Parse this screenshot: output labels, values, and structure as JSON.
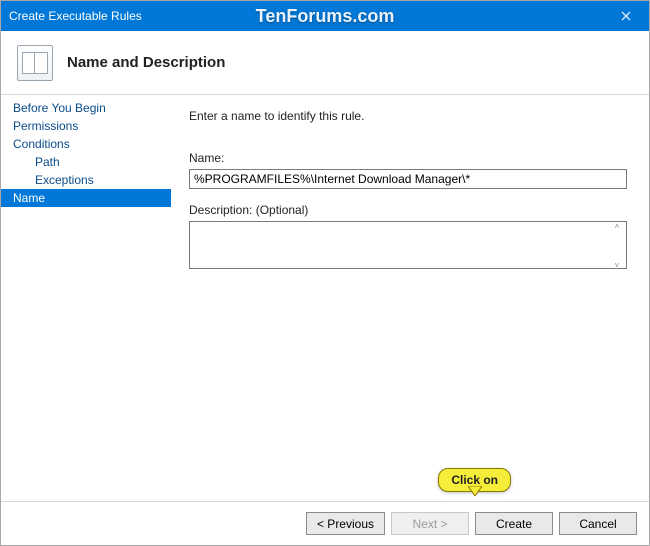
{
  "titlebar": {
    "title": "Create Executable Rules",
    "watermark": "TenForums.com"
  },
  "header": {
    "heading": "Name and Description"
  },
  "sidebar": {
    "items": [
      {
        "label": "Before You Begin",
        "sub": false,
        "selected": false
      },
      {
        "label": "Permissions",
        "sub": false,
        "selected": false
      },
      {
        "label": "Conditions",
        "sub": false,
        "selected": false
      },
      {
        "label": "Path",
        "sub": true,
        "selected": false
      },
      {
        "label": "Exceptions",
        "sub": true,
        "selected": false
      },
      {
        "label": "Name",
        "sub": false,
        "selected": true
      }
    ]
  },
  "main": {
    "instruction": "Enter a name to identify this rule.",
    "name_label": "Name:",
    "name_value": "%PROGRAMFILES%\\Internet Download Manager\\*",
    "desc_label": "Description: (Optional)",
    "desc_value": ""
  },
  "footer": {
    "previous": "< Previous",
    "next": "Next >",
    "create": "Create",
    "cancel": "Cancel"
  },
  "callout": {
    "text": "Click on"
  }
}
